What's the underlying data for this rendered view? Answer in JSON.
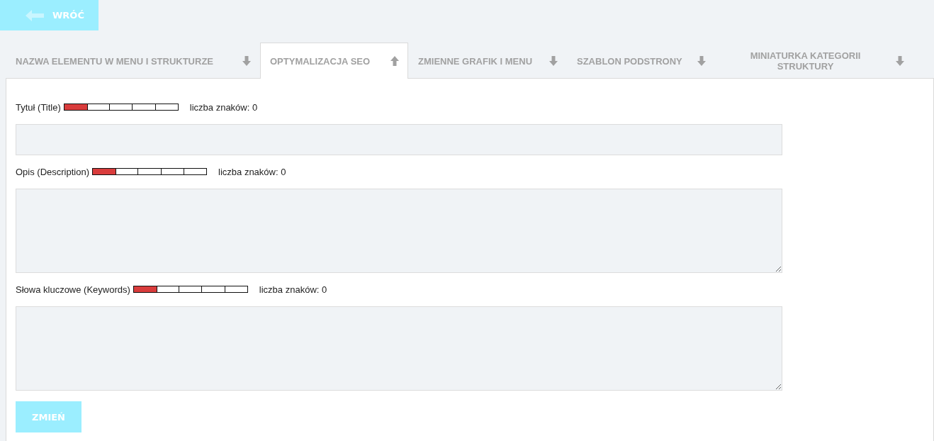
{
  "back_button": {
    "label": "WRÓĆ"
  },
  "tabs": [
    {
      "label": "NAZWA ELEMENTU W MENU I STRUKTURZE",
      "selected": false
    },
    {
      "label": "OPTYMALIZACJA SEO",
      "selected": true
    },
    {
      "label": "ZMIENNE GRAFIK I MENU",
      "selected": false
    },
    {
      "label": "SZABLON PODSTRONY",
      "selected": false
    },
    {
      "label": "MINIATURKA KATEGORII STRUKTURY",
      "selected": false
    }
  ],
  "fields": [
    {
      "kind": "input",
      "label": "Tytuł (Title)",
      "level": 0.2,
      "count": "liczba znaków: 0"
    },
    {
      "kind": "textarea",
      "label": "Opis (Description)",
      "level": 0.2,
      "count": "liczba znaków: 0"
    },
    {
      "kind": "textarea",
      "label": "Słowa kluczowe (Keywords)",
      "level": 0.2,
      "count": "liczba znaków: 0"
    }
  ],
  "submit_button": {
    "label": "ZMIEŃ"
  }
}
